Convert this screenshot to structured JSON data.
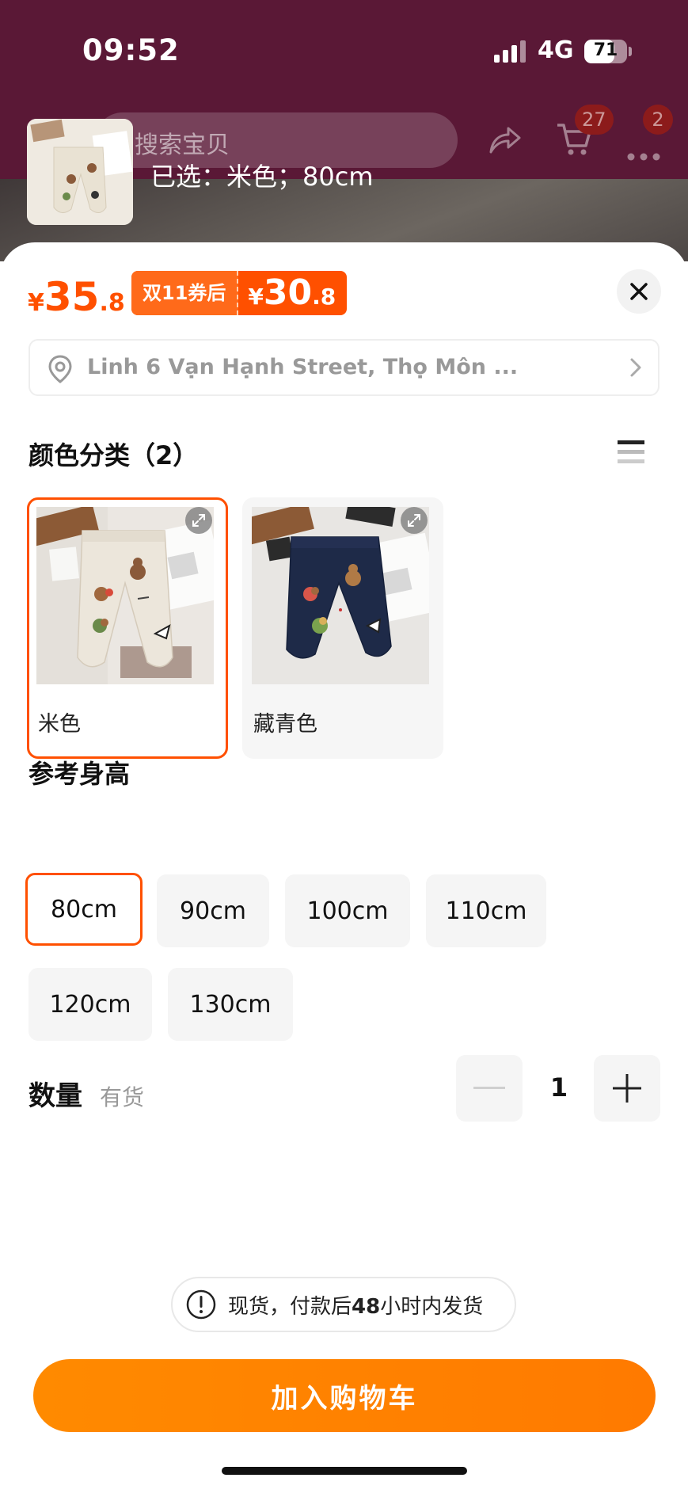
{
  "status_bar": {
    "time": "09:52",
    "network": "4G",
    "battery": "71",
    "battery_level": 0.71
  },
  "header": {
    "search_placeholder": "搜索宝贝",
    "cart_badge": "27",
    "more_badge": "2",
    "icons": [
      "share-icon",
      "cart-icon",
      "more-icon"
    ]
  },
  "sku_panel": {
    "selected_text": "已选：米色；80cm",
    "price": {
      "currency": "¥",
      "integer": "35",
      "decimal": ".8"
    },
    "coupon": {
      "label": "双11券后",
      "currency": "¥",
      "integer": "30",
      "decimal": ".8"
    },
    "address": "Linh 6 Vạn Hạnh Street, Thọ Môn ...",
    "color_section": {
      "title": "颜色分类（2）",
      "options": [
        {
          "label": "米色",
          "selected": true,
          "pants_color": "#ece6db"
        },
        {
          "label": "藏青色",
          "selected": false,
          "pants_color": "#1e2a48"
        }
      ]
    },
    "size_section": {
      "title": "参考身高",
      "options": [
        {
          "label": "80cm",
          "selected": true
        },
        {
          "label": "90cm",
          "selected": false
        },
        {
          "label": "100cm",
          "selected": false
        },
        {
          "label": "110cm",
          "selected": false
        },
        {
          "label": "120cm",
          "selected": false
        },
        {
          "label": "130cm",
          "selected": false
        }
      ]
    },
    "quantity": {
      "label": "数量",
      "stock": "有货",
      "value": "1"
    },
    "notice": {
      "prefix": "现货，付款后",
      "bold": "48",
      "suffix": "小时内发货"
    },
    "add_to_cart": "加入购物车"
  },
  "colors": {
    "accent": "#ff5000",
    "cta": "#ff8a00",
    "header_bg": "#5a1836"
  }
}
